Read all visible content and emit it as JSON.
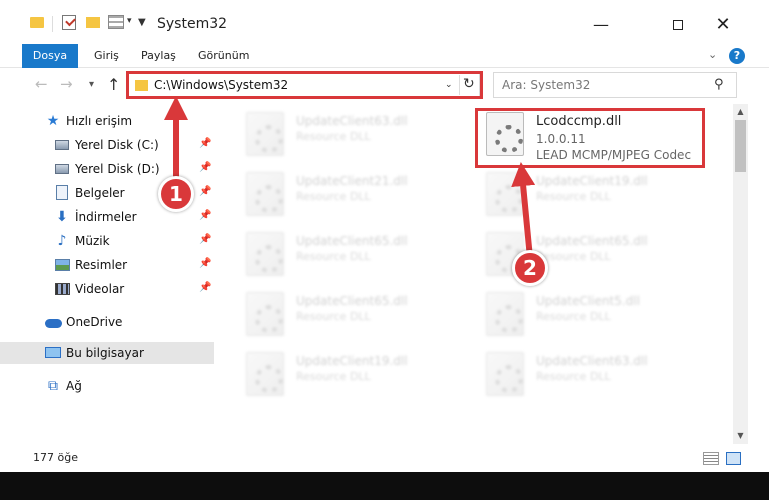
{
  "window": {
    "title": "System32",
    "minimize": "—",
    "close": "✕"
  },
  "ribbon": {
    "tabs": [
      "Dosya",
      "Giriş",
      "Paylaş",
      "Görünüm"
    ],
    "chevron": "⌄",
    "help": "?"
  },
  "nav": {
    "address": "C:\\Windows\\System32",
    "search_placeholder": "Ara: System32"
  },
  "sidebar": {
    "items": [
      {
        "label": "Hızlı erişim",
        "icon": "star-icon",
        "pinned": false
      },
      {
        "label": "Yerel Disk (C:)",
        "icon": "disk-icon",
        "pinned": true
      },
      {
        "label": "Yerel Disk (D:)",
        "icon": "disk-icon",
        "pinned": true
      },
      {
        "label": "Belgeler",
        "icon": "document-icon",
        "pinned": true
      },
      {
        "label": "İndirmeler",
        "icon": "download-icon",
        "pinned": true
      },
      {
        "label": "Müzik",
        "icon": "music-icon",
        "pinned": true
      },
      {
        "label": "Resimler",
        "icon": "picture-icon",
        "pinned": true
      },
      {
        "label": "Videolar",
        "icon": "video-icon",
        "pinned": true
      },
      {
        "label": "OneDrive",
        "icon": "cloud-icon",
        "pinned": false
      },
      {
        "label": "Bu bilgisayar",
        "icon": "computer-icon",
        "pinned": false,
        "selected": true
      },
      {
        "label": "Ağ",
        "icon": "network-icon",
        "pinned": false
      }
    ]
  },
  "files": {
    "left": [
      {
        "name": "UpdateClient63.dll",
        "type": "Resource DLL"
      },
      {
        "name": "UpdateClient21.dll",
        "type": "Resource DLL"
      },
      {
        "name": "UpdateClient65.dll",
        "type": "Resource DLL"
      },
      {
        "name": "UpdateClient65.dll",
        "type": "Resource DLL"
      },
      {
        "name": "UpdateClient19.dll",
        "type": "Resource DLL"
      }
    ],
    "right": [
      {
        "name": "UpdateClient19.dll",
        "type": "Resource DLL"
      },
      {
        "name": "UpdateClient65.dll",
        "type": "Resource DLL"
      },
      {
        "name": "UpdateClient5.dll",
        "type": "Resource DLL"
      },
      {
        "name": "UpdateClient63.dll",
        "type": "Resource DLL"
      }
    ],
    "target": {
      "name": "Lcodccmp.dll",
      "version": "1.0.0.11",
      "description": "LEAD MCMP/MJPEG Codec"
    }
  },
  "status": {
    "count": "177 öğe"
  },
  "annotations": {
    "step1": "1",
    "step2": "2",
    "color": "#d9383a"
  }
}
